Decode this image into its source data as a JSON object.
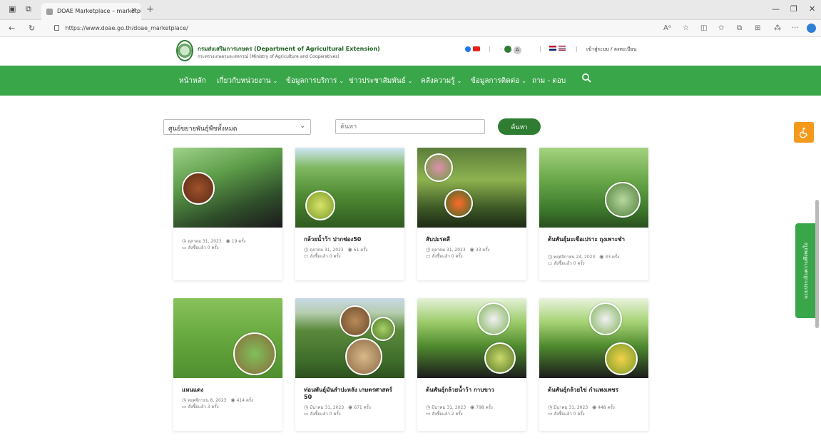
{
  "browser": {
    "tab_title": "DOAE Marketplace – marketplace",
    "url": "https://www.doae.go.th/doae_marketplace/"
  },
  "site": {
    "org_name": "กรมส่งเสริมการเกษตร (Department of Agricultural Extension)",
    "org_sub": "กระทรวงเกษตรและสหกรณ์ (Ministry of Agriculture and Cooperatives)",
    "font_a": "A",
    "login_label": "เข้าสู่ระบบ / ลงทะเบียน"
  },
  "nav": {
    "items": [
      {
        "label": "หน้าหลัก",
        "has_dropdown": false
      },
      {
        "label": "เกี่ยวกับหน่วยงาน",
        "has_dropdown": true
      },
      {
        "label": "ข้อมูลการบริการ",
        "has_dropdown": true
      },
      {
        "label": "ข่าวประชาสัมพันธ์",
        "has_dropdown": true
      },
      {
        "label": "คลังความรู้",
        "has_dropdown": true
      },
      {
        "label": "ข้อมูลการติดต่อ",
        "has_dropdown": true
      },
      {
        "label": "ถาม - ตอบ",
        "has_dropdown": false
      }
    ],
    "chevron": "⌄"
  },
  "filter": {
    "selected_center": "ศูนย์ขยายพันธุ์พืชทั้งหมด",
    "search_placeholder": "ค้นหา",
    "search_button": "ค้นหา"
  },
  "side_tab_label": "แบบประเมินความพึงพอใจ",
  "products": [
    {
      "title": "",
      "date": "ตุลาคม 31, 2023",
      "views": "19 ครั้ง",
      "orders": "สั่งซื้อแล้ว 0 ครั้ง"
    },
    {
      "title": "กล้วยน้ำว้า ปากช่อง50",
      "date": "ตุลาคม 31, 2023",
      "views": "61 ครั้ง",
      "orders": "สั่งซื้อแล้ว 0 ครั้ง"
    },
    {
      "title": "สับปะรดสี",
      "date": "ตุลาคม 31, 2023",
      "views": "33 ครั้ง",
      "orders": "สั่งซื้อแล้ว 0 ครั้ง"
    },
    {
      "title": "ต้นพันธุ์มะเขือเปราะ ถุงเพาะชำ",
      "date": "พฤศจิกายน 24, 2023",
      "views": "33 ครั้ง",
      "orders": "สั่งซื้อแล้ว 0 ครั้ง"
    },
    {
      "title": "แหนแดง",
      "date": "พฤศจิกายน 8, 2023",
      "views": "414 ครั้ง",
      "orders": "สั่งซื้อแล้ว 3 ครั้ง"
    },
    {
      "title": "ท่อนพันธุ์มันสำปะหลัง เกษตรศาสตร์ 50",
      "date": "มีนาคม 31, 2023",
      "views": "671 ครั้ง",
      "orders": "สั่งซื้อแล้ว 0 ครั้ง"
    },
    {
      "title": "ต้นพันธุ์กล้วยน้ำว้า กาบขาว",
      "date": "มีนาคม 31, 2023",
      "views": "798 ครั้ง",
      "orders": "สั่งซื้อแล้ว 2 ครั้ง"
    },
    {
      "title": "ต้นพันธุ์กล้วยไข่ กำแพงเพชร",
      "date": "มีนาคม 31, 2023",
      "views": "448 ครั้ง",
      "orders": "สั่งซื้อแล้ว 0 ครั้ง"
    }
  ]
}
